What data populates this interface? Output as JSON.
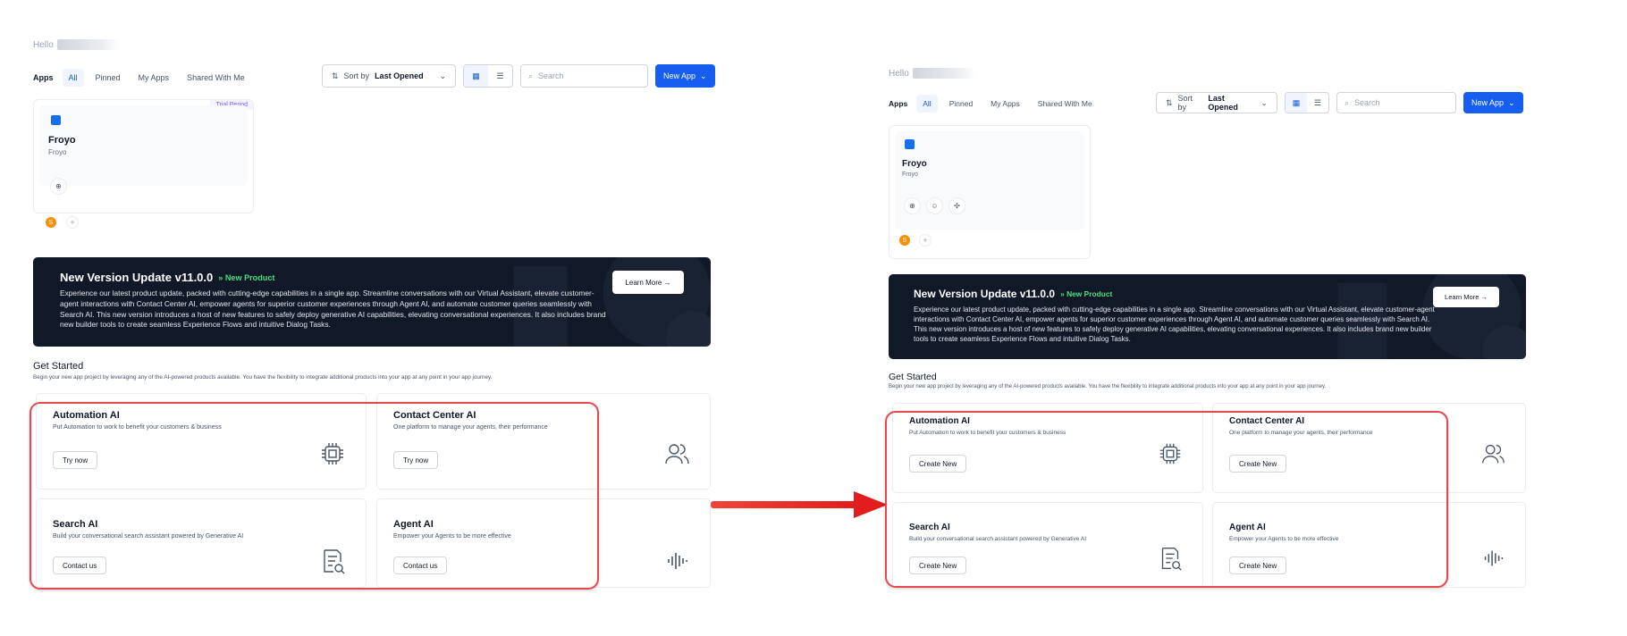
{
  "colors": {
    "accent": "#155eef",
    "highlight": "#e5484d",
    "banner_bg": "#111827",
    "new_product": "#4ade80"
  },
  "left": {
    "hello": "Hello",
    "tabs": {
      "apps": "Apps",
      "all": "All",
      "pinned": "Pinned",
      "my_apps": "My Apps",
      "shared": "Shared With Me"
    },
    "sort": {
      "label": "Sort by",
      "value": "Last Opened"
    },
    "search": {
      "placeholder": "Search"
    },
    "new_app": "New App",
    "app": {
      "badge": "Trial Period",
      "name": "Froyo",
      "subtitle": "Froyo",
      "avatar": "S",
      "add": "+"
    },
    "banner": {
      "title": "New Version Update v11.0.0",
      "tag": "New Product",
      "text": "Experience our latest product update, packed with cutting-edge capabilities in a single app. Streamline conversations with our Virtual Assistant, elevate customer-agent interactions with Contact Center AI, empower agents for superior customer experiences through Agent AI, and automate customer queries seamlessly with Search AI. This new version introduces a host of new features to safely deploy generative AI capabilities, elevating conversational experiences. It also includes brand new builder tools to create seamless Experience Flows and intuitive Dialog Tasks.",
      "learn_more": "Learn More →"
    },
    "get_started": {
      "title": "Get Started",
      "subtitle": "Begin your new app project by leveraging any of the AI-powered products available. You have the flexibility to integrate additional products into your app at any point in your app journey."
    },
    "products": [
      {
        "title": "Automation AI",
        "desc": "Put Automation to work to benefit your customers & business",
        "button": "Try now",
        "icon": "chip-icon"
      },
      {
        "title": "Contact Center AI",
        "desc": "One platform to manage your agents, their performance",
        "button": "Try now",
        "icon": "users-icon"
      },
      {
        "title": "Search AI",
        "desc": "Build your conversational search assistant powered by Generative AI",
        "button": "Contact us",
        "icon": "search-doc-icon"
      },
      {
        "title": "Agent AI",
        "desc": "Empower your Agents to be more effective",
        "button": "Contact us",
        "icon": "voice-wave-icon"
      }
    ]
  },
  "right": {
    "hello": "Hello",
    "tabs": {
      "apps": "Apps",
      "all": "All",
      "pinned": "Pinned",
      "my_apps": "My Apps",
      "shared": "Shared With Me"
    },
    "sort": {
      "label": "Sort by",
      "value": "Last Opened"
    },
    "search": {
      "placeholder": "Search"
    },
    "new_app": "New App",
    "app": {
      "name": "Froyo",
      "subtitle": "Froyo",
      "avatar": "S",
      "add": "+"
    },
    "banner": {
      "title": "New Version Update v11.0.0",
      "tag": "New Product",
      "text": "Experience our latest product update, packed with cutting-edge capabilities in a single app. Streamline conversations with our Virtual Assistant, elevate customer-agent interactions with Contact Center AI, empower agents for superior customer experiences through Agent AI, and automate customer queries seamlessly with Search AI. This new version introduces a host of new features to safely deploy generative AI capabilities, elevating conversational experiences. It also includes brand new builder tools to create seamless Experience Flows and intuitive Dialog Tasks.",
      "learn_more": "Learn More →"
    },
    "get_started": {
      "title": "Get Started",
      "subtitle": "Begin your new app project by leveraging any of the AI-powered products available. You have the flexibility to integrate additional products into your app at any point in your app journey."
    },
    "products": [
      {
        "title": "Automation AI",
        "desc": "Put Automation to work to benefit your customers & business",
        "button": "Create New",
        "icon": "chip-icon"
      },
      {
        "title": "Contact Center AI",
        "desc": "One platform to manage your agents, their performance",
        "button": "Create New",
        "icon": "users-icon"
      },
      {
        "title": "Search AI",
        "desc": "Build your conversational search assistant powered by Generative AI",
        "button": "Create New",
        "icon": "search-doc-icon"
      },
      {
        "title": "Agent AI",
        "desc": "Empower your Agents to be more effective",
        "button": "Create New",
        "icon": "voice-wave-icon"
      }
    ]
  }
}
